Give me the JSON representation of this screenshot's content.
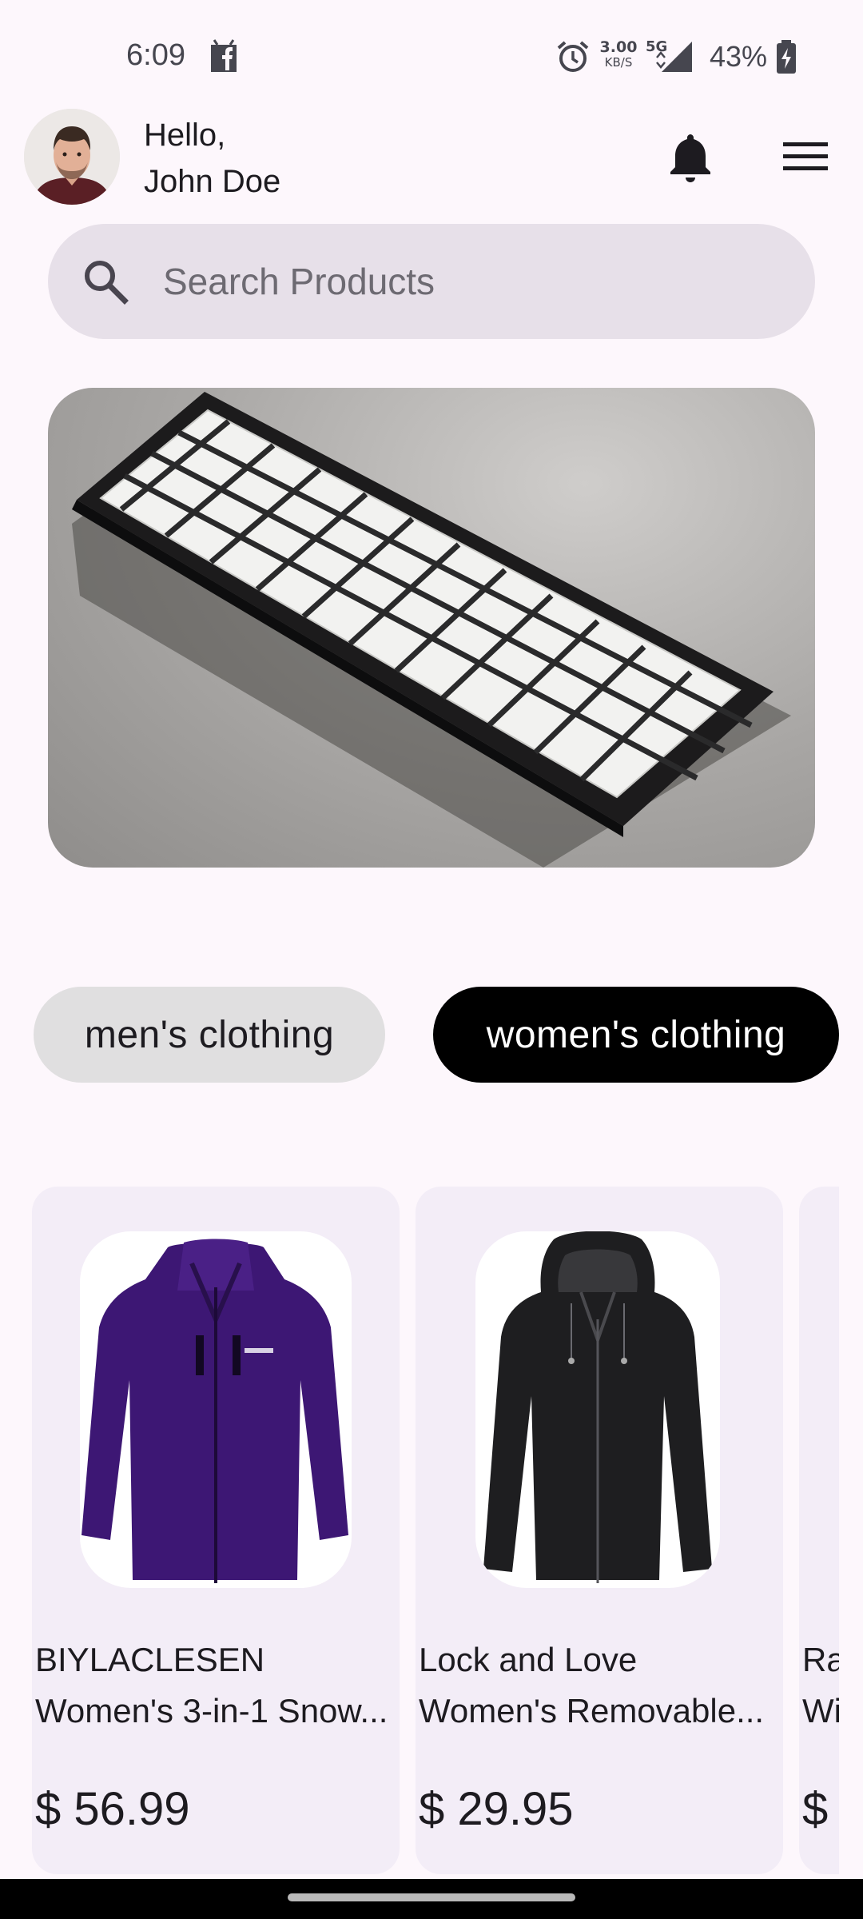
{
  "status_bar": {
    "time": "6:09",
    "net_speed_value": "3.00",
    "net_speed_unit": "KB/S",
    "network_type": "5G",
    "battery_percent": "43%",
    "icons": [
      "facebook-icon",
      "alarm-icon",
      "signal-icon",
      "battery-charging-icon"
    ]
  },
  "header": {
    "greeting_line1": "Hello,",
    "greeting_line2": "John Doe",
    "icons": [
      "avatar",
      "bell-icon",
      "menu-icon"
    ]
  },
  "search": {
    "placeholder": "Search Products",
    "value": ""
  },
  "categories": [
    {
      "label": "men's clothing",
      "selected": false
    },
    {
      "label": "women's clothing",
      "selected": true
    }
  ],
  "products": [
    {
      "title_line1": "BIYLACLESEN",
      "title_line2": "Women's 3-in-1 Snow...",
      "price": "$ 56.99"
    },
    {
      "title_line1": "Lock and Love",
      "title_line2": "Women's Removable...",
      "price": "$ 29.95"
    },
    {
      "title_line1": "Ra",
      "title_line2": "Wi",
      "price": "$"
    }
  ],
  "colors": {
    "background": "#fdf7fc",
    "search_bg": "#e7e0e9",
    "card_bg": "#f3edf7",
    "chip_selected": "#000000",
    "chip_unselected": "#e0dfe0"
  }
}
